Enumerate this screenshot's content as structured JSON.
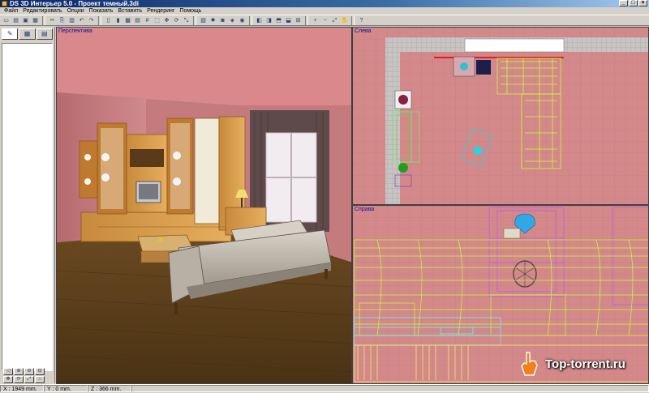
{
  "window": {
    "title": "DS 3D Интерьер 5.0 - Проект темный.3di"
  },
  "menu": [
    "Файл",
    "Редактировать",
    "Опции",
    "Показать",
    "Вставить",
    "Рендеринг",
    "Помощь"
  ],
  "views": {
    "perspective": "Перспектива",
    "left": "Слева",
    "right": "Справа"
  },
  "status": {
    "x": "X : 1949 mm.",
    "y": "Y : 0 mm.",
    "z": "Z : 366 mm."
  },
  "watermark": {
    "text": "Top-torrent.ru"
  },
  "colors": {
    "window_bg": "#d4d0c8",
    "title_start": "#0a246a",
    "wall": "#d4878a",
    "floor": "#5a4020",
    "wireframe": "#c8ff30"
  }
}
